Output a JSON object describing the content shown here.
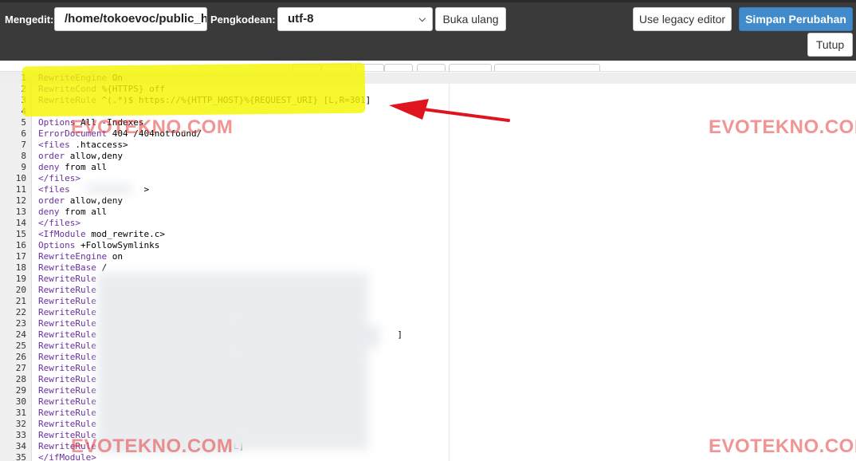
{
  "toolbar": {
    "editing_label": "Mengedit:",
    "path_value": "/home/tokoevoc/public_h",
    "encoding_label": "Pengkodean:",
    "encoding_value": "utf-8",
    "reload_label": "Buka ulang",
    "legacy_label": "Use legacy editor",
    "save_label": "Simpan Perubahan",
    "close_label": "Tutup"
  },
  "editor": {
    "lines": [
      {
        "n": "1",
        "a": "RewriteEngine",
        "b": " On"
      },
      {
        "n": "2",
        "a": "RewriteCond",
        "b": " %{HTTPS} off"
      },
      {
        "n": "3",
        "a": "RewriteRule",
        "b": " ^(.*)$ https://%{HTTP_HOST}%{REQUEST_URI} [L,R=301]"
      },
      {
        "n": "4",
        "a": "",
        "b": ""
      },
      {
        "n": "5",
        "a": "Options",
        "b": " All -Indexes"
      },
      {
        "n": "6",
        "a": "ErrorDocument",
        "b": " 404 /404notfound/"
      },
      {
        "n": "7",
        "a": "<files",
        "b": " .htaccess>"
      },
      {
        "n": "8",
        "a": "order",
        "b": " allow,deny"
      },
      {
        "n": "9",
        "a": "deny",
        "b": " from all"
      },
      {
        "n": "10",
        "a": "</files>",
        "b": ""
      },
      {
        "n": "11",
        "a": "<files",
        "b": "              >"
      },
      {
        "n": "12",
        "a": "order",
        "b": " allow,deny"
      },
      {
        "n": "13",
        "a": "deny",
        "b": " from all"
      },
      {
        "n": "14",
        "a": "</files>",
        "b": ""
      },
      {
        "n": "15",
        "a": "<IfModule",
        "b": " mod_rewrite.c>"
      },
      {
        "n": "16",
        "a": "Options",
        "b": " +FollowSymlinks"
      },
      {
        "n": "17",
        "a": "RewriteEngine",
        "b": " on"
      },
      {
        "n": "18",
        "a": "RewriteBase",
        "b": " /"
      },
      {
        "n": "19",
        "a": "RewriteRule",
        "b": ""
      },
      {
        "n": "20",
        "a": "RewriteRule",
        "b": ""
      },
      {
        "n": "21",
        "a": "RewriteRule",
        "b": ""
      },
      {
        "n": "22",
        "a": "RewriteRule",
        "b": ""
      },
      {
        "n": "23",
        "a": "RewriteRule",
        "b": ""
      },
      {
        "n": "24",
        "a": "RewriteRule",
        "b": "                                                         ]"
      },
      {
        "n": "25",
        "a": "RewriteRule",
        "b": ""
      },
      {
        "n": "26",
        "a": "RewriteRule",
        "b": ""
      },
      {
        "n": "27",
        "a": "RewriteRule",
        "b": ""
      },
      {
        "n": "28",
        "a": "RewriteRule",
        "b": ""
      },
      {
        "n": "29",
        "a": "RewriteRule",
        "b": ""
      },
      {
        "n": "30",
        "a": "RewriteRule",
        "b": ""
      },
      {
        "n": "31",
        "a": "RewriteRule",
        "b": ""
      },
      {
        "n": "32",
        "a": "RewriteRule",
        "b": ""
      },
      {
        "n": "33",
        "a": "RewriteRule",
        "b": ""
      },
      {
        "n": "34",
        "a": "RewriteRule",
        "b": "                         [L]"
      },
      {
        "n": "35",
        "a": "</ifModule>",
        "b": ""
      }
    ]
  },
  "watermarks": {
    "text": "EVOTEKNO.COM",
    "color": "#e63c3c"
  },
  "colors": {
    "topbar": "#3a3a3a",
    "primary_button": "#428bca",
    "keyword": "#6a2fa0",
    "highlight": "#f5f500",
    "arrow": "#e0141e"
  }
}
